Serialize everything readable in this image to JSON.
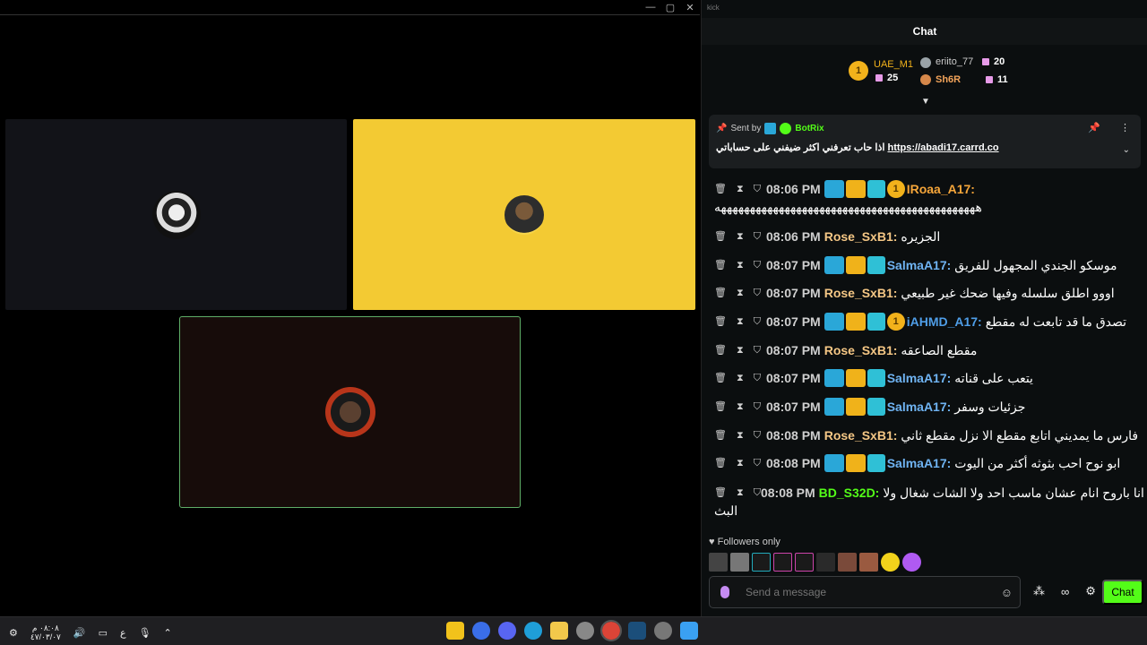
{
  "window": {
    "controls": [
      "—",
      "▢",
      "✕"
    ]
  },
  "chat": {
    "app_title": "kick",
    "title": "Chat",
    "leaderboard": [
      {
        "name": "UAE_M1",
        "count": "25",
        "rank": "1"
      },
      {
        "name": "eriito_77",
        "count": "20"
      },
      {
        "name": "Sh6R",
        "count": "11"
      }
    ],
    "pinned": {
      "sent_by": "Sent by",
      "bot": "BotRix",
      "text_ar": "اذا حاب تعرفني اكثر ضيفني على حساباتي",
      "link": "https://abadi17.carrd.co"
    },
    "messages": [
      {
        "time": "08:06 PM",
        "user": "IRoaa_A17:",
        "color": "#f6a63a",
        "badges": [
          "mod",
          "vip",
          "og",
          "sub"
        ],
        "sub": "1",
        "text": "",
        "wrap": "هههههههههههههههههههههههههههههههههههههههههههههه"
      },
      {
        "time": "08:06 PM",
        "user": "Rose_SxB1:",
        "color": "#f5c785",
        "badges": [],
        "text": "الجزيره"
      },
      {
        "time": "08:07 PM",
        "user": "SalmaA17:",
        "color": "#6fb3f2",
        "badges": [
          "mod",
          "vip",
          "og"
        ],
        "text": "موسكو الجندي المجهول للفريق"
      },
      {
        "time": "08:07 PM",
        "user": "Rose_SxB1:",
        "color": "#f5c785",
        "badges": [],
        "text": "اووو اطلق سلسله وفيها ضحك غير طبيعي"
      },
      {
        "time": "08:07 PM",
        "user": "iAHMD_A17:",
        "color": "#4f9ee8",
        "badges": [
          "mod",
          "vip",
          "og",
          "sub"
        ],
        "sub": "1",
        "text": "تصدق ما قد تابعت له مقطع"
      },
      {
        "time": "08:07 PM",
        "user": "Rose_SxB1:",
        "color": "#f5c785",
        "badges": [],
        "text": "مقطع الصاعقه"
      },
      {
        "time": "08:07 PM",
        "user": "SalmaA17:",
        "color": "#6fb3f2",
        "badges": [
          "mod",
          "vip",
          "og"
        ],
        "text": "يتعب على قناته"
      },
      {
        "time": "08:07 PM",
        "user": "SalmaA17:",
        "color": "#6fb3f2",
        "badges": [
          "mod",
          "vip",
          "og"
        ],
        "text": "جزئيات وسفر"
      },
      {
        "time": "08:08 PM",
        "user": "Rose_SxB1:",
        "color": "#f5c785",
        "badges": [],
        "text": "فارس ما يمديني اتابع مقطع الا نزل مقطع ثاني"
      },
      {
        "time": "08:08 PM",
        "user": "SalmaA17:",
        "color": "#6fb3f2",
        "badges": [
          "mod",
          "vip",
          "og"
        ],
        "text": "ابو نوح احب بثوثه أكثر من اليوت"
      },
      {
        "time": "08:08 PM",
        "user": "BD_S32D:",
        "color": "#53fc18",
        "badges": [],
        "text": "انا باروح انام عشان ماسب احد ولا الشات شغال ولا",
        "wrap": "البث"
      }
    ],
    "followers_only": "Followers only",
    "input_placeholder": "Send a message",
    "infinity": "∞",
    "send_label": "Chat"
  },
  "taskbar": {
    "clock_time": "٠٨:٠٨ م",
    "clock_date": "٤٧/٠٣/٠٧",
    "lang": "ع"
  }
}
